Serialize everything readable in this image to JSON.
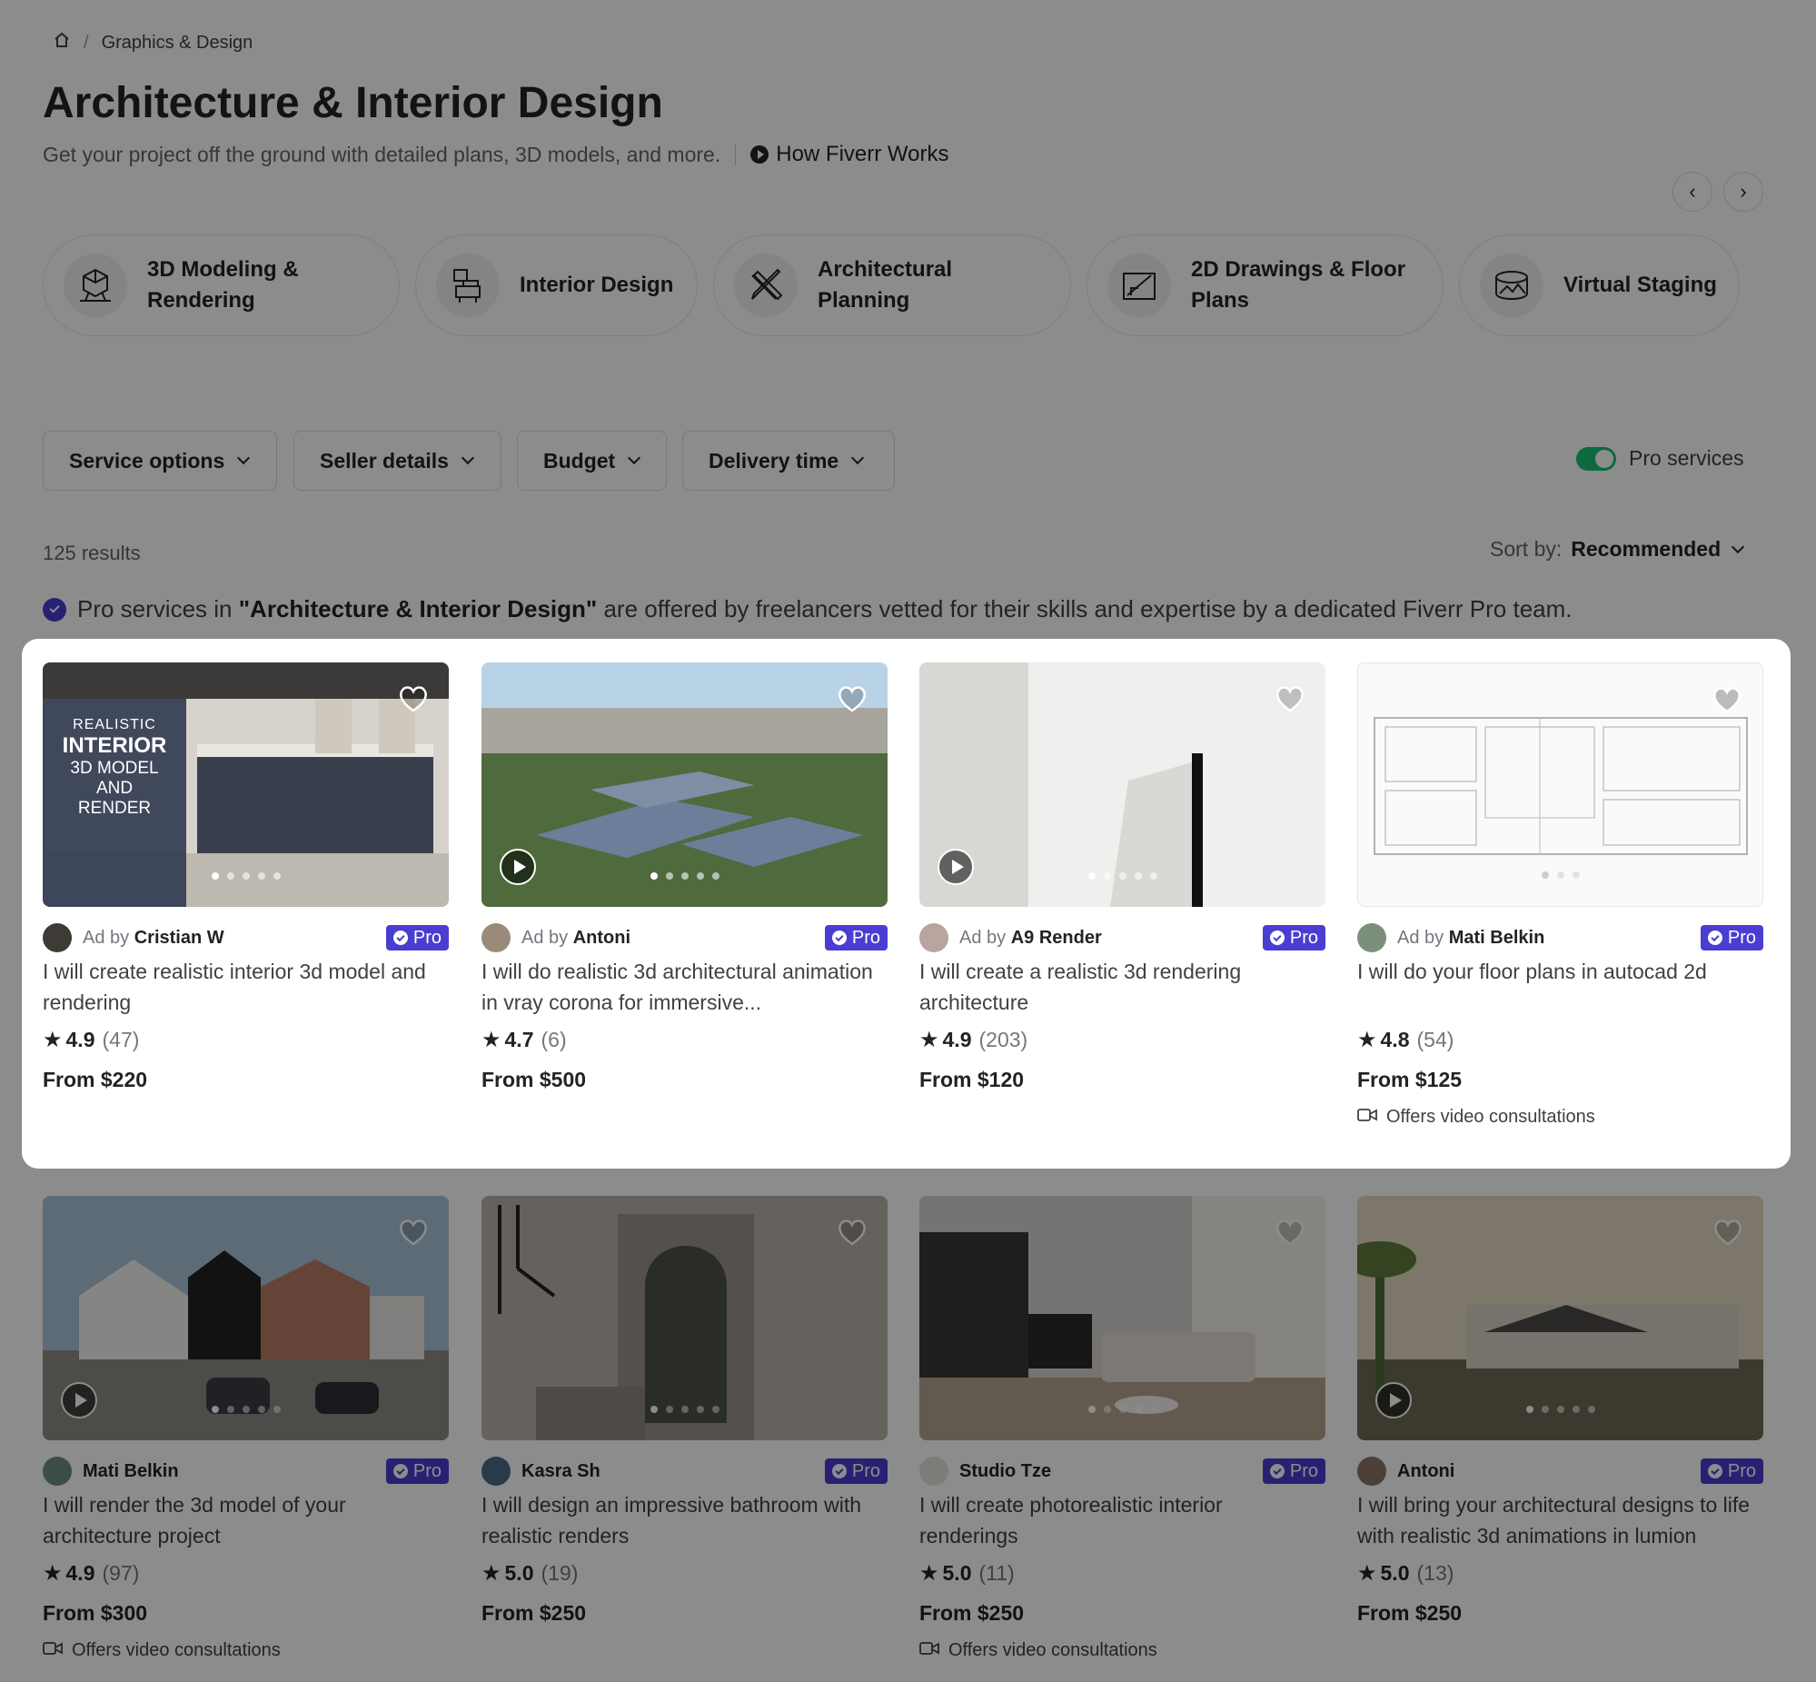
{
  "breadcrumb": {
    "home_icon": "home-icon",
    "item": "Graphics & Design"
  },
  "header": {
    "title": "Architecture & Interior Design",
    "subtitle": "Get your project off the ground with detailed plans, 3D models, and more.",
    "how_link": "How Fiverr Works"
  },
  "categories": [
    {
      "line1": "3D Modeling &",
      "line2": "Rendering",
      "icon": "3d-model-icon"
    },
    {
      "line1": "Interior Design",
      "line2": "",
      "icon": "furniture-icon"
    },
    {
      "line1": "Architectural",
      "line2": "Planning",
      "icon": "ruler-pencil-icon"
    },
    {
      "line1": "2D Drawings & Floor",
      "line2": "Plans",
      "icon": "drafting-icon"
    },
    {
      "line1": "Virtual Staging",
      "line2": "",
      "icon": "360-view-icon"
    }
  ],
  "filters": [
    "Service options",
    "Seller details",
    "Budget",
    "Delivery time"
  ],
  "pro_toggle": {
    "label": "Pro services",
    "on": true
  },
  "results_count": "125 results",
  "sort": {
    "label": "Sort by:",
    "value": "Recommended"
  },
  "pro_note": {
    "prefix": "Pro services in ",
    "category": "\"Architecture & Interior Design\"",
    "suffix": " are offered by freelancers vetted for their skills and expertise by a dedicated Fiverr Pro team."
  },
  "thumb_overlay": {
    "line1": "REALISTIC",
    "line2": "INTERIOR",
    "line3": "3D MODEL",
    "line4": "AND",
    "line5": "RENDER"
  },
  "gigs": [
    {
      "ad_prefix": "Ad by",
      "seller": "Cristian W",
      "title": "I will create realistic interior 3d model and rendering",
      "rating": "4.9",
      "reviews": "(47)",
      "price": "From $220",
      "video": "",
      "pro": "Pro"
    },
    {
      "ad_prefix": "Ad by",
      "seller": "Antoni",
      "title": "I will do realistic 3d architectural animation in vray corona for immersive...",
      "rating": "4.7",
      "reviews": "(6)",
      "price": "From $500",
      "video": "",
      "pro": "Pro"
    },
    {
      "ad_prefix": "Ad by",
      "seller": "A9 Render",
      "title": "I will create a realistic 3d rendering architecture",
      "rating": "4.9",
      "reviews": "(203)",
      "price": "From $120",
      "video": "",
      "pro": "Pro"
    },
    {
      "ad_prefix": "Ad by",
      "seller": "Mati Belkin",
      "title": "I will do your floor plans in autocad 2d",
      "rating": "4.8",
      "reviews": "(54)",
      "price": "From $125",
      "video": "Offers video consultations",
      "pro": "Pro"
    },
    {
      "ad_prefix": "",
      "seller": "Mati Belkin",
      "title": "I will render the 3d model of your architecture project",
      "rating": "4.9",
      "reviews": "(97)",
      "price": "From $300",
      "video": "Offers video consultations",
      "pro": "Pro"
    },
    {
      "ad_prefix": "",
      "seller": "Kasra Sh",
      "title": "I will design an impressive bathroom with realistic renders",
      "rating": "5.0",
      "reviews": "(19)",
      "price": "From $250",
      "video": "",
      "pro": "Pro"
    },
    {
      "ad_prefix": "",
      "seller": "Studio Tze",
      "title": "I will create photorealistic interior renderings",
      "rating": "5.0",
      "reviews": "(11)",
      "price": "From $250",
      "video": "Offers video consultations",
      "pro": "Pro"
    },
    {
      "ad_prefix": "",
      "seller": "Antoni",
      "title": "I will bring your architectural designs to life with realistic 3d animations in lumion",
      "rating": "5.0",
      "reviews": "(13)",
      "price": "From $250",
      "video": "",
      "pro": "Pro"
    }
  ],
  "colors": {
    "pro": "#4a3dd1",
    "toggle": "#1dbf73",
    "overlay": "rgba(0,0,0,0.45)"
  }
}
